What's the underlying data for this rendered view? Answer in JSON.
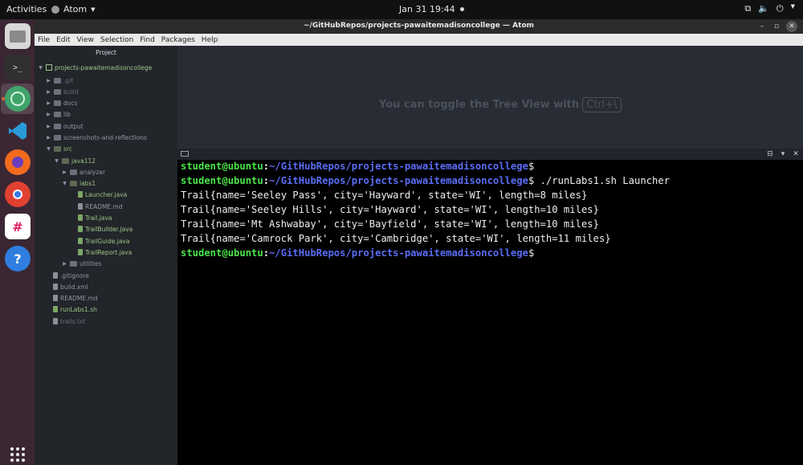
{
  "topbar": {
    "activities": "Activities",
    "app_name": "Atom",
    "clock": "Jan 31  19:44"
  },
  "window": {
    "title": "~/GitHubRepos/projects-pawaitemadisoncollege — Atom"
  },
  "menu": [
    "File",
    "Edit",
    "View",
    "Selection",
    "Find",
    "Packages",
    "Help"
  ],
  "tree": {
    "header": "Project",
    "items": [
      {
        "label": "projects-pawaitemadisoncollege",
        "kind": "repo"
      },
      {
        "label": ".git",
        "kind": "folder"
      },
      {
        "label": "build",
        "kind": "folder"
      },
      {
        "label": "docs",
        "kind": "folder"
      },
      {
        "label": "lib",
        "kind": "folder"
      },
      {
        "label": "output",
        "kind": "folder"
      },
      {
        "label": "screenshots-and-reflections",
        "kind": "folder"
      },
      {
        "label": "src",
        "kind": "folder"
      },
      {
        "label": "java112",
        "kind": "folder"
      },
      {
        "label": "analyzer",
        "kind": "folder"
      },
      {
        "label": "labs1",
        "kind": "folder"
      },
      {
        "label": "Launcher.java",
        "kind": "file"
      },
      {
        "label": "README.md",
        "kind": "file"
      },
      {
        "label": "Trail.java",
        "kind": "file"
      },
      {
        "label": "TrailBuilder.java",
        "kind": "file"
      },
      {
        "label": "TrailGuide.java",
        "kind": "file"
      },
      {
        "label": "TrailReport.java",
        "kind": "file"
      },
      {
        "label": "utilities",
        "kind": "folder"
      },
      {
        "label": ".gitignore",
        "kind": "file"
      },
      {
        "label": "build.xml",
        "kind": "file"
      },
      {
        "label": "README.md",
        "kind": "file"
      },
      {
        "label": "runLabs1.sh",
        "kind": "file"
      },
      {
        "label": "trails.txt",
        "kind": "file"
      }
    ]
  },
  "editor": {
    "hint_text": "You can toggle the Tree View with",
    "hint_key": "Ctrl+\\"
  },
  "terminal": {
    "prompt_user": "student@ubuntu",
    "prompt_sep": ":",
    "prompt_path": "~/GitHubRepos/projects-pawaitemadisoncollege",
    "prompt_end": "$",
    "command": " ./runLabs1.sh Launcher",
    "output": [
      "Trail{name='Seeley Pass', city='Hayward', state='WI', length=8 miles}",
      "Trail{name='Seeley Hills', city='Hayward', state='WI', length=10 miles}",
      "Trail{name='Mt Ashwabay', city='Bayfield', state='WI', length=10 miles}",
      "Trail{name='Camrock Park', city='Cambridge', state='WI', length=11 miles}"
    ]
  },
  "colors": {
    "prompt_user": "#4be44b",
    "prompt_path": "#5a6cf5",
    "git_modified": "#9fc486",
    "dock_bg": "#3a2733"
  }
}
